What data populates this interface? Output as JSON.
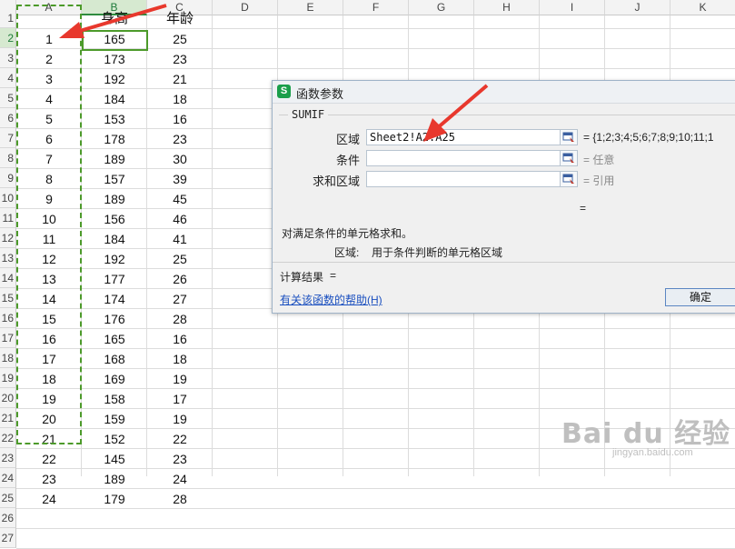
{
  "columns": [
    "A",
    "B",
    "C",
    "D",
    "E",
    "F",
    "G",
    "H",
    "I",
    "J",
    "K"
  ],
  "rows": [
    "1",
    "2",
    "3",
    "4",
    "5",
    "6",
    "7",
    "8",
    "9",
    "10",
    "11",
    "12",
    "13",
    "14",
    "15",
    "16",
    "17",
    "18",
    "19",
    "20",
    "21",
    "22",
    "23",
    "24",
    "25",
    "26",
    "27"
  ],
  "header_row": {
    "a": "",
    "b": "身高",
    "c": "年龄"
  },
  "data_rows": [
    {
      "a": "1",
      "b": "165",
      "c": "25"
    },
    {
      "a": "2",
      "b": "173",
      "c": "23"
    },
    {
      "a": "3",
      "b": "192",
      "c": "21"
    },
    {
      "a": "4",
      "b": "184",
      "c": "18"
    },
    {
      "a": "5",
      "b": "153",
      "c": "16"
    },
    {
      "a": "6",
      "b": "178",
      "c": "23"
    },
    {
      "a": "7",
      "b": "189",
      "c": "30"
    },
    {
      "a": "8",
      "b": "157",
      "c": "39"
    },
    {
      "a": "9",
      "b": "189",
      "c": "45"
    },
    {
      "a": "10",
      "b": "156",
      "c": "46"
    },
    {
      "a": "11",
      "b": "184",
      "c": "41"
    },
    {
      "a": "12",
      "b": "192",
      "c": "25"
    },
    {
      "a": "13",
      "b": "177",
      "c": "26"
    },
    {
      "a": "14",
      "b": "174",
      "c": "27"
    },
    {
      "a": "15",
      "b": "176",
      "c": "28"
    },
    {
      "a": "16",
      "b": "165",
      "c": "16"
    },
    {
      "a": "17",
      "b": "168",
      "c": "18"
    },
    {
      "a": "18",
      "b": "169",
      "c": "19"
    },
    {
      "a": "19",
      "b": "158",
      "c": "17"
    },
    {
      "a": "20",
      "b": "159",
      "c": "19"
    },
    {
      "a": "21",
      "b": "152",
      "c": "22"
    },
    {
      "a": "22",
      "b": "145",
      "c": "23"
    },
    {
      "a": "23",
      "b": "189",
      "c": "24"
    },
    {
      "a": "24",
      "b": "179",
      "c": "28"
    }
  ],
  "dialog": {
    "title": "函数参数",
    "logo": "S",
    "function_name": "SUMIF",
    "params": [
      {
        "label": "区域",
        "value": "Sheet2!A2:A25",
        "result": "= {1;2;3;4;5;6;7;8;9;10;11;1",
        "result_gray": false
      },
      {
        "label": "条件",
        "value": "",
        "result": "= 任意",
        "result_gray": true
      },
      {
        "label": "求和区域",
        "value": "",
        "result": "= 引用",
        "result_gray": true
      }
    ],
    "result_eq": "=",
    "description": "对满足条件的单元格求和。",
    "param_desc_label": "区域:",
    "param_desc_text": "用于条件判断的单元格区域",
    "calc_label": "计算结果",
    "calc_eq": "=",
    "help_link": "有关该函数的帮助(H)",
    "ok_label": "确定"
  },
  "colors": {
    "selection": "#4c9a2a",
    "arrow": "#e8382d",
    "link": "#1a4fbf"
  },
  "icons": {
    "ref_button": "range-select-icon",
    "logo": "wps-logo-icon"
  },
  "watermark": {
    "text": "Bai du 经验",
    "subtext": "jingyan.baidu.com"
  }
}
